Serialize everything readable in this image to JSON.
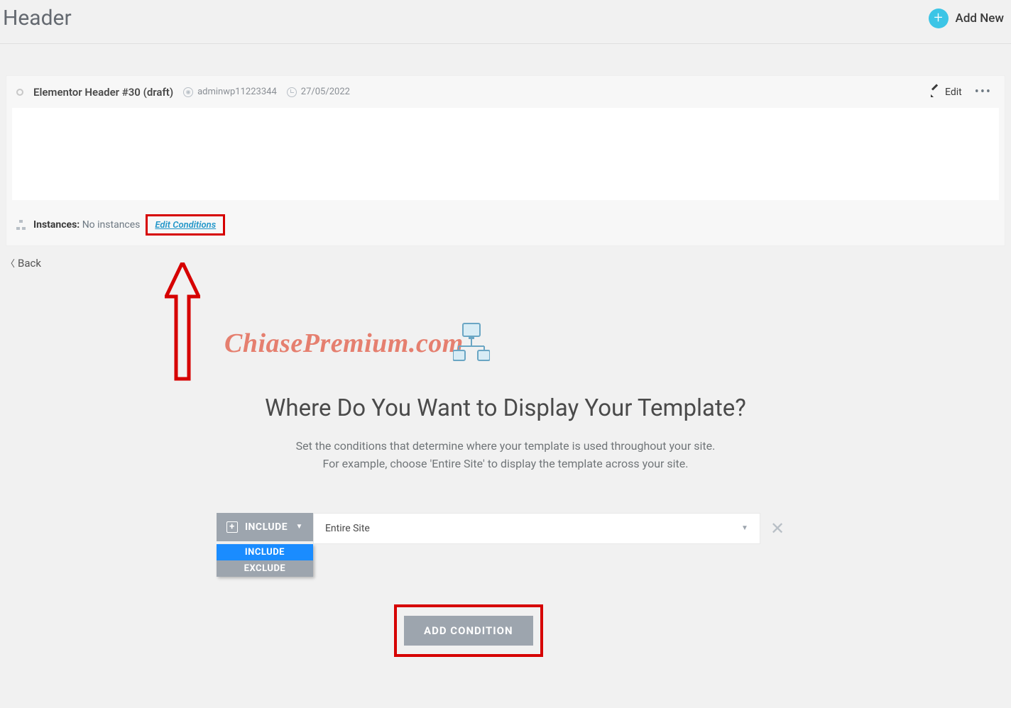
{
  "header": {
    "title": "Header",
    "add_new": "Add New"
  },
  "card": {
    "title": "Elementor Header #30 (draft)",
    "author": "adminwp11223344",
    "date": "27/05/2022",
    "edit": "Edit",
    "instances_label": "Instances:",
    "instances_value": "No instances",
    "edit_conditions": "Edit Conditions"
  },
  "back": "Back",
  "watermark": "ChiasePremium.com",
  "conditions": {
    "title": "Where Do You Want to Display Your Template?",
    "desc1": "Set the conditions that determine where your template is used throughout your site.",
    "desc2": "For example, choose 'Entire Site' to display the template across your site.",
    "include_label": "INCLUDE",
    "dd_include": "INCLUDE",
    "dd_exclude": "EXCLUDE",
    "select_value": "Entire Site",
    "add_button": "ADD CONDITION"
  }
}
